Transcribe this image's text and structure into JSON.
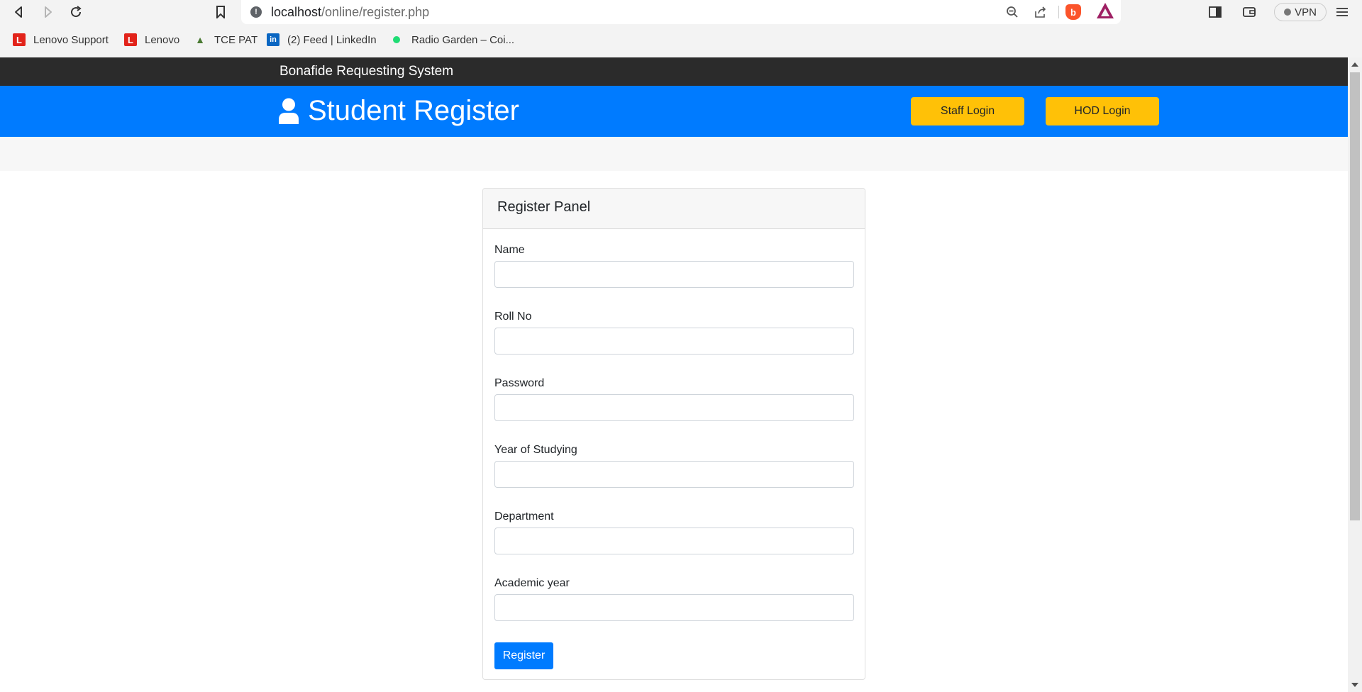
{
  "browser": {
    "url_host": "localhost",
    "url_path": "/online/register.php",
    "vpn_label": "VPN",
    "bookmarks": [
      {
        "label": "Lenovo Support",
        "favicon": "L"
      },
      {
        "label": "Lenovo",
        "favicon": "L"
      },
      {
        "label": "TCE PAT",
        "favicon": "tce-logo"
      },
      {
        "label": "(2) Feed | LinkedIn",
        "favicon": "in"
      },
      {
        "label": "Radio Garden – Coi...",
        "favicon": "green-dot"
      }
    ]
  },
  "site": {
    "brand": "Bonafide Requesting System",
    "page_title": "Student Register",
    "title_icon": "user-icon",
    "buttons": {
      "staff_login": "Staff Login",
      "hod_login": "HOD Login"
    },
    "colors": {
      "primary": "#007bff",
      "warning": "#ffc107",
      "topbar": "#2b2b2b"
    }
  },
  "form": {
    "panel_title": "Register Panel",
    "fields": [
      {
        "label": "Name",
        "value": ""
      },
      {
        "label": "Roll No",
        "value": ""
      },
      {
        "label": "Password",
        "value": ""
      },
      {
        "label": "Year of Studying",
        "value": ""
      },
      {
        "label": "Department",
        "value": ""
      },
      {
        "label": "Academic year",
        "value": ""
      }
    ],
    "submit_label": "Register"
  }
}
